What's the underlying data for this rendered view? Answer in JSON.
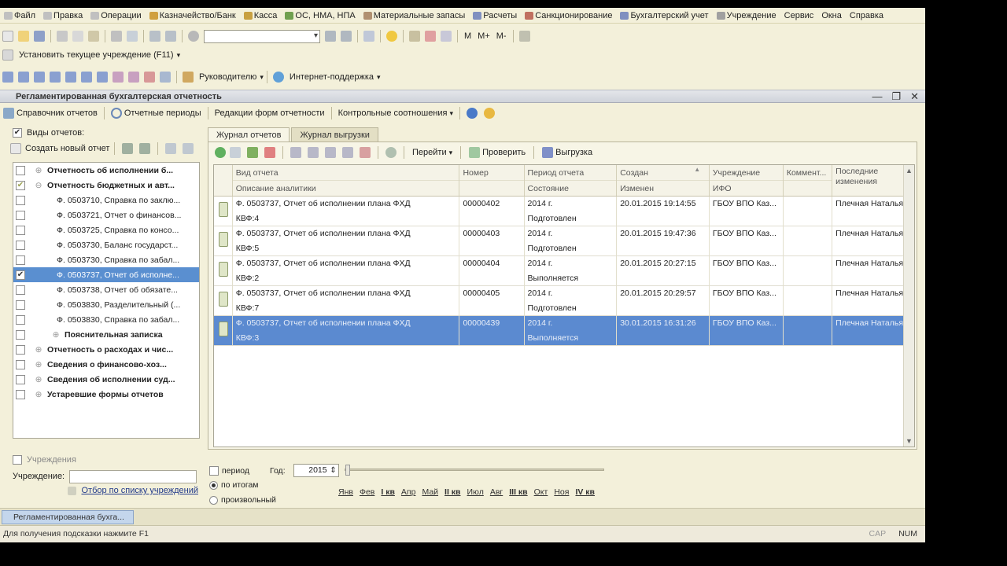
{
  "menu": [
    "Файл",
    "Правка",
    "Операции",
    "Казначейство/Банк",
    "Касса",
    "ОС, НМА, НПА",
    "Материальные запасы",
    "Расчеты",
    "Санкционирование",
    "Бухгалтерский учет",
    "Учреждение",
    "Сервис",
    "Окна",
    "Справка"
  ],
  "toolbar2": {
    "set_institution": "Установить текущее учреждение (F11)"
  },
  "toolbar3": {
    "manager": "Руководителю",
    "support": "Интернет-поддержка"
  },
  "window": {
    "title": "Регламентированная бухгалтерская отчетность",
    "minimize": "—",
    "restore": "❐",
    "close": "✕"
  },
  "actions": [
    "Справочник отчетов",
    "Отчетные периоды",
    "Редакции форм отчетности",
    "Контрольные соотношения"
  ],
  "left": {
    "header": "Виды отчетов:",
    "create_new": "Создать новый отчет",
    "tree": [
      {
        "text": "Отчетность об исполнении б...",
        "bold": true,
        "level": 0,
        "exp": "+",
        "checked": false,
        "selected": false
      },
      {
        "text": "Отчетность бюджетных и авт...",
        "bold": true,
        "level": 0,
        "exp": "−",
        "checked": true,
        "selected": false
      },
      {
        "text": "Ф. 0503710, Справка по заклю...",
        "bold": false,
        "level": 1,
        "exp": "",
        "checked": false,
        "selected": false
      },
      {
        "text": "Ф. 0503721, Отчет о финансов...",
        "bold": false,
        "level": 1,
        "exp": "",
        "checked": false,
        "selected": false
      },
      {
        "text": "Ф. 0503725, Справка по консо...",
        "bold": false,
        "level": 1,
        "exp": "",
        "checked": false,
        "selected": false
      },
      {
        "text": "Ф. 0503730, Баланс государст...",
        "bold": false,
        "level": 1,
        "exp": "",
        "checked": false,
        "selected": false
      },
      {
        "text": "Ф. 0503730, Справка по забал...",
        "bold": false,
        "level": 1,
        "exp": "",
        "checked": false,
        "selected": false
      },
      {
        "text": "Ф. 0503737, Отчет об исполне...",
        "bold": false,
        "level": 1,
        "exp": "",
        "checked": true,
        "selected": true
      },
      {
        "text": "Ф. 0503738, Отчет об обязате...",
        "bold": false,
        "level": 1,
        "exp": "",
        "checked": false,
        "selected": false
      },
      {
        "text": "Ф. 0503830, Разделительный (...",
        "bold": false,
        "level": 1,
        "exp": "",
        "checked": false,
        "selected": false
      },
      {
        "text": "Ф. 0503830, Справка по забал...",
        "bold": false,
        "level": 1,
        "exp": "",
        "checked": false,
        "selected": false
      },
      {
        "text": "Пояснительная записка",
        "bold": true,
        "level": 1,
        "exp": "+",
        "checked": false,
        "selected": false
      },
      {
        "text": "Отчетность о расходах и чис...",
        "bold": true,
        "level": 0,
        "exp": "+",
        "checked": false,
        "selected": false
      },
      {
        "text": "Сведения о финансово-хоз...",
        "bold": true,
        "level": 0,
        "exp": "+",
        "checked": false,
        "selected": false
      },
      {
        "text": "Сведения об исполнении суд...",
        "bold": true,
        "level": 0,
        "exp": "+",
        "checked": false,
        "selected": false
      },
      {
        "text": "Устаревшие формы отчетов",
        "bold": true,
        "level": 0,
        "exp": "+",
        "checked": false,
        "selected": false
      }
    ],
    "inst_check": "Учреждения",
    "inst_label": "Учреждение:",
    "inst_value": "",
    "inst_link": "Отбор по списку учреждений"
  },
  "tabs": [
    "Журнал отчетов",
    "Журнал выгрузки"
  ],
  "right_toolbar": {
    "goto": "Перейти",
    "check": "Проверить",
    "upload": "Выгрузка"
  },
  "grid": {
    "headers": [
      [
        "Вид отчета",
        "Описание аналитики"
      ],
      [
        "Номер",
        ""
      ],
      [
        "Период отчета",
        "Состояние"
      ],
      [
        "Создан",
        "Изменен"
      ],
      [
        "Учреждение",
        "ИФО"
      ],
      [
        "Коммент...",
        ""
      ],
      [
        "Последние изменения",
        ""
      ]
    ],
    "rows": [
      {
        "c": [
          "Ф. 0503737, Отчет об исполнении плана ФХД",
          "КВФ:4",
          "00000402",
          "2014 г.",
          "Подготовлен",
          "20.01.2015 19:14:55",
          "",
          "ГБОУ ВПО Каз...",
          "",
          "",
          "Плечная Наталья ..."
        ],
        "selected": false
      },
      {
        "c": [
          "Ф. 0503737, Отчет об исполнении плана ФХД",
          "КВФ:5",
          "00000403",
          "2014 г.",
          "Подготовлен",
          "20.01.2015 19:47:36",
          "",
          "ГБОУ ВПО Каз...",
          "",
          "",
          "Плечная Наталья ..."
        ],
        "selected": false
      },
      {
        "c": [
          "Ф. 0503737, Отчет об исполнении плана ФХД",
          "КВФ:2",
          "00000404",
          "2014 г.",
          "Выполняется",
          "20.01.2015 20:27:15",
          "",
          "ГБОУ ВПО Каз...",
          "",
          "",
          "Плечная Наталья ..."
        ],
        "selected": false
      },
      {
        "c": [
          "Ф. 0503737, Отчет об исполнении плана ФХД",
          "КВФ:7",
          "00000405",
          "2014 г.",
          "Подготовлен",
          "20.01.2015 20:29:57",
          "",
          "ГБОУ ВПО Каз...",
          "",
          "",
          "Плечная Наталья ..."
        ],
        "selected": false
      },
      {
        "c": [
          "Ф. 0503737, Отчет об исполнении плана ФХД",
          "КВФ:3",
          "00000439",
          "2014 г.",
          "Выполняется",
          "30.01.2015 16:31:26",
          "",
          "ГБОУ ВПО Каз...",
          "",
          "",
          "Плечная Наталья ..."
        ],
        "selected": true
      }
    ]
  },
  "period": {
    "period_label": "период",
    "year_label": "Год:",
    "year": "2015",
    "by_totals": "по итогам",
    "arbitrary": "произвольный",
    "months": [
      "Янв",
      "Фев",
      "I кв",
      "Апр",
      "Май",
      "II кв",
      "Июл",
      "Авг",
      "III кв",
      "Окт",
      "Ноя",
      "IV кв"
    ]
  },
  "taskbar": {
    "item": "Регламентированная бухга..."
  },
  "status": {
    "hint": "Для получения подсказки нажмите F1",
    "cap": "CAP",
    "num": "NUM"
  },
  "colors": {
    "selection": "#5b8ad0",
    "panel": "#f3f0da",
    "title": "#d6dae1"
  }
}
